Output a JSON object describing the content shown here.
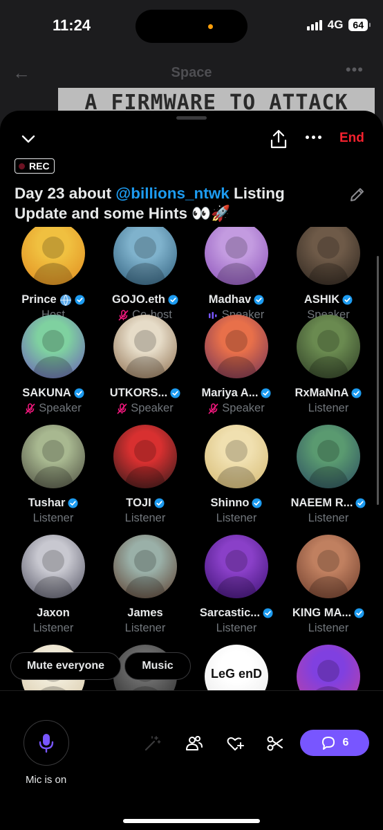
{
  "status_bar": {
    "time": "11:24",
    "network": "4G",
    "battery": "64"
  },
  "background": {
    "title": "Space",
    "banner_text": "A FIRMWARE TO ATTACK"
  },
  "space": {
    "end_label": "End",
    "rec_label": "REC",
    "title_before": "Day 23 about ",
    "title_handle": "@billions_ntwk",
    "title_after": " Listing Update and some Hints 👀🚀"
  },
  "participants": [
    {
      "name": "Prince",
      "role": "Host",
      "verified": true,
      "globe": true,
      "mic": "none",
      "color1": "#f0c040",
      "color2": "#e08a1e"
    },
    {
      "name": "GOJO.eth",
      "role": "Co-host",
      "verified": true,
      "mic": "muted",
      "color1": "#7fb2cc",
      "color2": "#2d5c7a"
    },
    {
      "name": "Madhav",
      "role": "Speaker",
      "verified": true,
      "mic": "speaking",
      "color1": "#c39be0",
      "color2": "#8a4fb8"
    },
    {
      "name": "ASHIK",
      "role": "Speaker",
      "verified": true,
      "mic": "none",
      "color1": "#6e5a48",
      "color2": "#2c241d"
    },
    {
      "name": "SAKUNA",
      "role": "Speaker",
      "verified": true,
      "mic": "muted",
      "color1": "#7fd1a0",
      "color2": "#6a5ab8"
    },
    {
      "name": "UTKORS...",
      "role": "Speaker",
      "verified": true,
      "mic": "muted",
      "color1": "#e6dcc8",
      "color2": "#8a6a4a"
    },
    {
      "name": "Mariya A...",
      "role": "Speaker",
      "verified": true,
      "mic": "muted",
      "color1": "#e8704a",
      "color2": "#6a3058"
    },
    {
      "name": "RxMaNnA",
      "role": "Listener",
      "verified": true,
      "mic": "none",
      "color1": "#6a8a50",
      "color2": "#2c3a24"
    },
    {
      "name": "Tushar",
      "role": "Listener",
      "verified": true,
      "mic": "none",
      "color1": "#a8b890",
      "color2": "#4a4a3e"
    },
    {
      "name": "TOJI",
      "role": "Listener",
      "verified": true,
      "mic": "none",
      "color1": "#d83030",
      "color2": "#2a1a1a"
    },
    {
      "name": "Shinno",
      "role": "Listener",
      "verified": true,
      "mic": "none",
      "color1": "#f0e0b0",
      "color2": "#d4b870"
    },
    {
      "name": "NAEEM R...",
      "role": "Listener",
      "verified": true,
      "mic": "none",
      "color1": "#5a9a70",
      "color2": "#2a4a60"
    },
    {
      "name": "Jaxon",
      "role": "Listener",
      "verified": false,
      "mic": "none",
      "color1": "#c8c8d0",
      "color2": "#505060"
    },
    {
      "name": "James",
      "role": "Listener",
      "verified": false,
      "mic": "none",
      "color1": "#9ab0a8",
      "color2": "#5a3a2a"
    },
    {
      "name": "Sarcastic...",
      "role": "Listener",
      "verified": true,
      "mic": "none",
      "color1": "#8a40c8",
      "color2": "#3a1070"
    },
    {
      "name": "KING MA...",
      "role": "Listener",
      "verified": true,
      "mic": "none",
      "color1": "#c08060",
      "color2": "#6a3a2a"
    },
    {
      "name": "",
      "role": "",
      "verified": false,
      "mic": "none",
      "color1": "#f0ead8",
      "color2": "#d8c8a8"
    },
    {
      "name": "",
      "role": "",
      "verified": false,
      "mic": "none",
      "color1": "#6a6a6a",
      "color2": "#2a2a2a"
    },
    {
      "name": "",
      "role": "",
      "verified": false,
      "mic": "none",
      "color1": "#ffffff",
      "color2": "#e8e8e8",
      "logo_text": "LeG enD"
    },
    {
      "name": "",
      "role": "",
      "verified": false,
      "mic": "none",
      "color1": "#8040e0",
      "color2": "#c040a0"
    }
  ],
  "actions": {
    "mute_everyone": "Mute everyone",
    "music": "Music"
  },
  "bottom": {
    "mic_label": "Mic is on",
    "comment_count": "6"
  }
}
